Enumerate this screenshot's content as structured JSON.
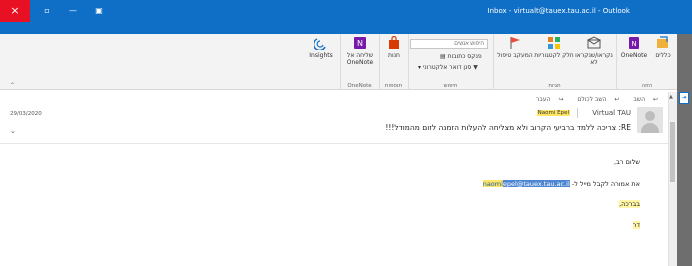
{
  "titlebar": {
    "title": "Inbox - virtualt@tauex.tau.ac.il - Outlook",
    "close_icon": "×",
    "restore_icon": "▫",
    "minimize_icon": "—",
    "layout_icon": "▣"
  },
  "ribbon": {
    "collapse_icon": "⌃",
    "groups": {
      "insights": {
        "label": "Insights"
      },
      "onenote": {
        "label": "OneNote",
        "button": "שליחה אל OneNote"
      },
      "addins": {
        "label": "תוספות",
        "button": "חנות"
      },
      "find": {
        "label": "חיפוש",
        "search_placeholder": "חיפוש אנשים",
        "address_book": "פנקס כתובות",
        "filter_email": "סנן דואר אלקטרוני"
      },
      "tags": {
        "label": "תגיות",
        "unread_read": "נקראו/שנקראו לא",
        "categorize": "חלק לקטגוריות",
        "followup": "המעקב טיפול"
      },
      "move": {
        "label": "הזזה",
        "rules": "כללים",
        "onenote_btn": "OneNote"
      }
    },
    "edge_button": "⇥"
  },
  "message": {
    "actions": {
      "reply": "השב",
      "reply_all": "השב לכולם",
      "forward": "העבר"
    },
    "date": "29/03/2020",
    "sender": "Virtual TAU",
    "recipient": "Naomi Epel",
    "subject": "RE: צריכה ללמד ברביעי הקרוב ולא מצליחה להעלות הזמנה לזום מהמודל!!!",
    "body": {
      "greeting": "שלום רב,",
      "request_prefix": "את אמורה לקבל מייל ל-",
      "email_hl": "naomi",
      "email_rest": "epel@tauex.tau.ac.il",
      "blessing": "בברכה,",
      "signature": "דר"
    }
  },
  "colors": {
    "accent": "#0f6fc6",
    "close_red": "#e81123",
    "highlight_yellow": "#ffe564"
  }
}
